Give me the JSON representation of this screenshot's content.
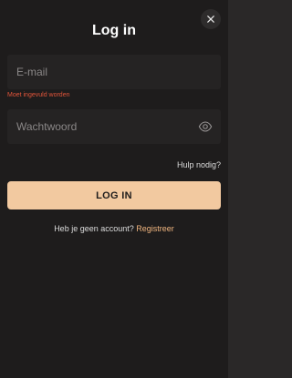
{
  "header": {
    "title": "Log in",
    "close_icon": "close-icon"
  },
  "form": {
    "email": {
      "value": "",
      "placeholder": "E-mail",
      "error": "Moet ingevuld worden"
    },
    "password": {
      "value": "",
      "placeholder": "Wachtwoord",
      "toggle_icon": "eye-icon"
    },
    "help_link": "Hulp nodig?",
    "submit_label": "LOG IN"
  },
  "footer": {
    "prompt": "Heb je geen account?",
    "register_link": "Registreer"
  },
  "colors": {
    "background": "#1e1c1c",
    "field": "#252323",
    "accent": "#f2c9a0",
    "link": "#f0b57f",
    "error": "#e2553a"
  }
}
